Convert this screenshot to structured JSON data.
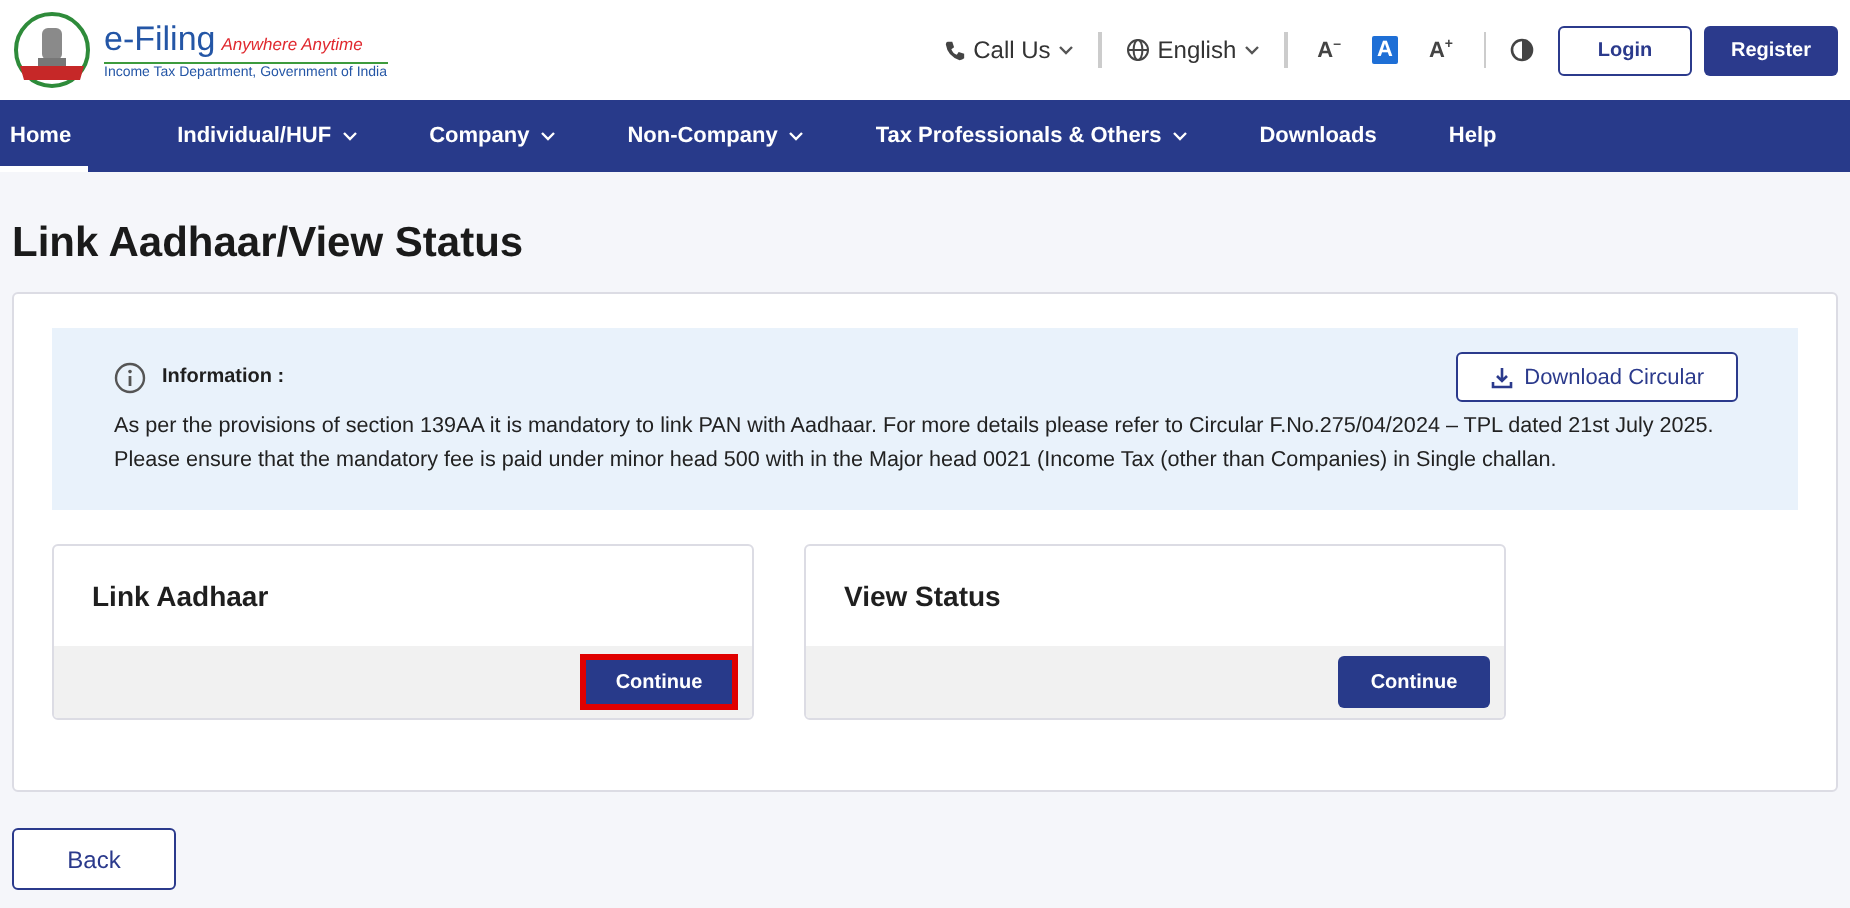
{
  "header": {
    "brand": "e-Filing",
    "tagline": "Anywhere Anytime",
    "department": "Income Tax Department, Government of India",
    "call_us": "Call Us",
    "language": "English",
    "font_sizes": [
      {
        "label": "A$^{–}$",
        "selected": false
      },
      {
        "label": "A",
        "selected": true
      },
      {
        "label": "A$^{+}$",
        "selected": false
      }
    ],
    "login": "Login",
    "register": "Register"
  },
  "nav": [
    {
      "label": "Home",
      "selected": true,
      "dropdown": false
    },
    {
      "label": "Individual/HUF",
      "selected": false,
      "dropdown": true
    },
    {
      "label": "Company",
      "selected": false,
      "dropdown": true
    },
    {
      "label": "Non-Company",
      "selected": false,
      "dropdown": true
    },
    {
      "label": "Tax Professionals & Others",
      "selected": false,
      "dropdown": true
    },
    {
      "label": "Downloads",
      "selected": false,
      "dropdown": false
    },
    {
      "label": "Help",
      "selected": false,
      "dropdown": false
    }
  ],
  "page_title": "Link Aadhaar/View Status",
  "information": {
    "heading": "Information :",
    "download_button": "Download Circular",
    "paragraphs": [
      "As per the provisions of section 139AA it is mandatory to link PAN with Aadhaar. For more details please refer to Circular F.No.275/04/2024 – TPL dated 21st July 2025.",
      "Please ensure that the mandatory fee is paid under minor head 500 with in the Major head 0021 (Income Tax (other than Companies) in Single challan."
    ]
  },
  "cards": [
    {
      "title": "Link Aadhaar",
      "button": "Continue",
      "highlighted": true
    },
    {
      "title": "View Status",
      "button": "Continue",
      "highlighted": false
    }
  ],
  "back_button": "Back"
}
